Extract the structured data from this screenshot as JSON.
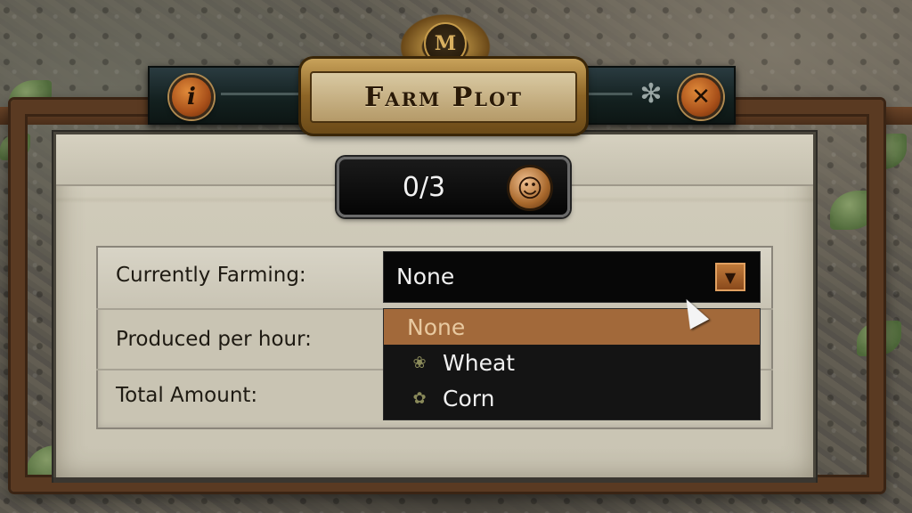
{
  "window": {
    "title": "Farm Plot",
    "crest_monogram": "M",
    "info_icon": "info-icon",
    "close_icon": "close-icon"
  },
  "workers": {
    "count_label": "0/3",
    "add_icon": "add-worker-icon"
  },
  "fields": {
    "currently_farming_label": "Currently Farming:",
    "produced_per_hour_label": "Produced per hour:",
    "total_amount_label": "Total Amount:"
  },
  "dropdown": {
    "selected_value": "None",
    "options": [
      {
        "label": "None",
        "icon": ""
      },
      {
        "label": "Wheat",
        "icon": "wheat-icon"
      },
      {
        "label": "Corn",
        "icon": "corn-icon"
      }
    ]
  },
  "colors": {
    "accent": "#a2693a",
    "button_orange": "#c07a3a",
    "title_gold": "#c8a25a"
  }
}
